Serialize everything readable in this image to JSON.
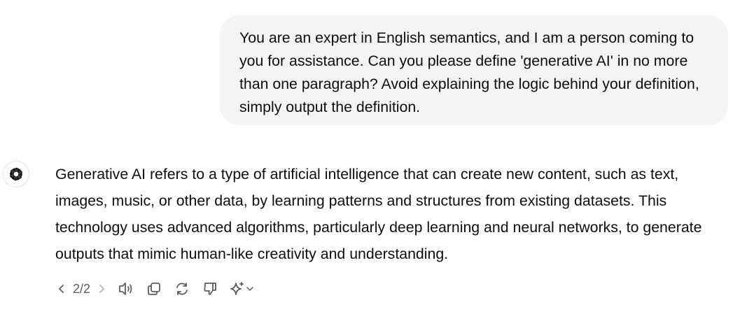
{
  "conversation": {
    "user_message": "You are an expert in English semantics, and I am a person coming to you for assistance. Can you please define 'generative AI' in no more than one paragraph? Avoid explaining the logic behind your definition, simply output the definition.",
    "assistant_message": "Generative AI refers to a type of artificial intelligence that can create new content, such as text, images, music, or other data, by learning patterns and structures from existing datasets. This technology uses advanced algorithms, particularly deep learning and neural networks, to generate outputs that mimic human-like creativity and understanding."
  },
  "actions": {
    "pager": "2/2",
    "icons": [
      "chevron-left-icon",
      "chevron-right-icon",
      "speaker-icon",
      "copy-icon",
      "regenerate-icon",
      "thumbs-down-icon",
      "sparkle-icon",
      "chevron-down-icon"
    ]
  },
  "colors": {
    "bubble_bg": "#f4f4f4",
    "text": "#0d0d0d",
    "icon": "#5d5d5d"
  }
}
